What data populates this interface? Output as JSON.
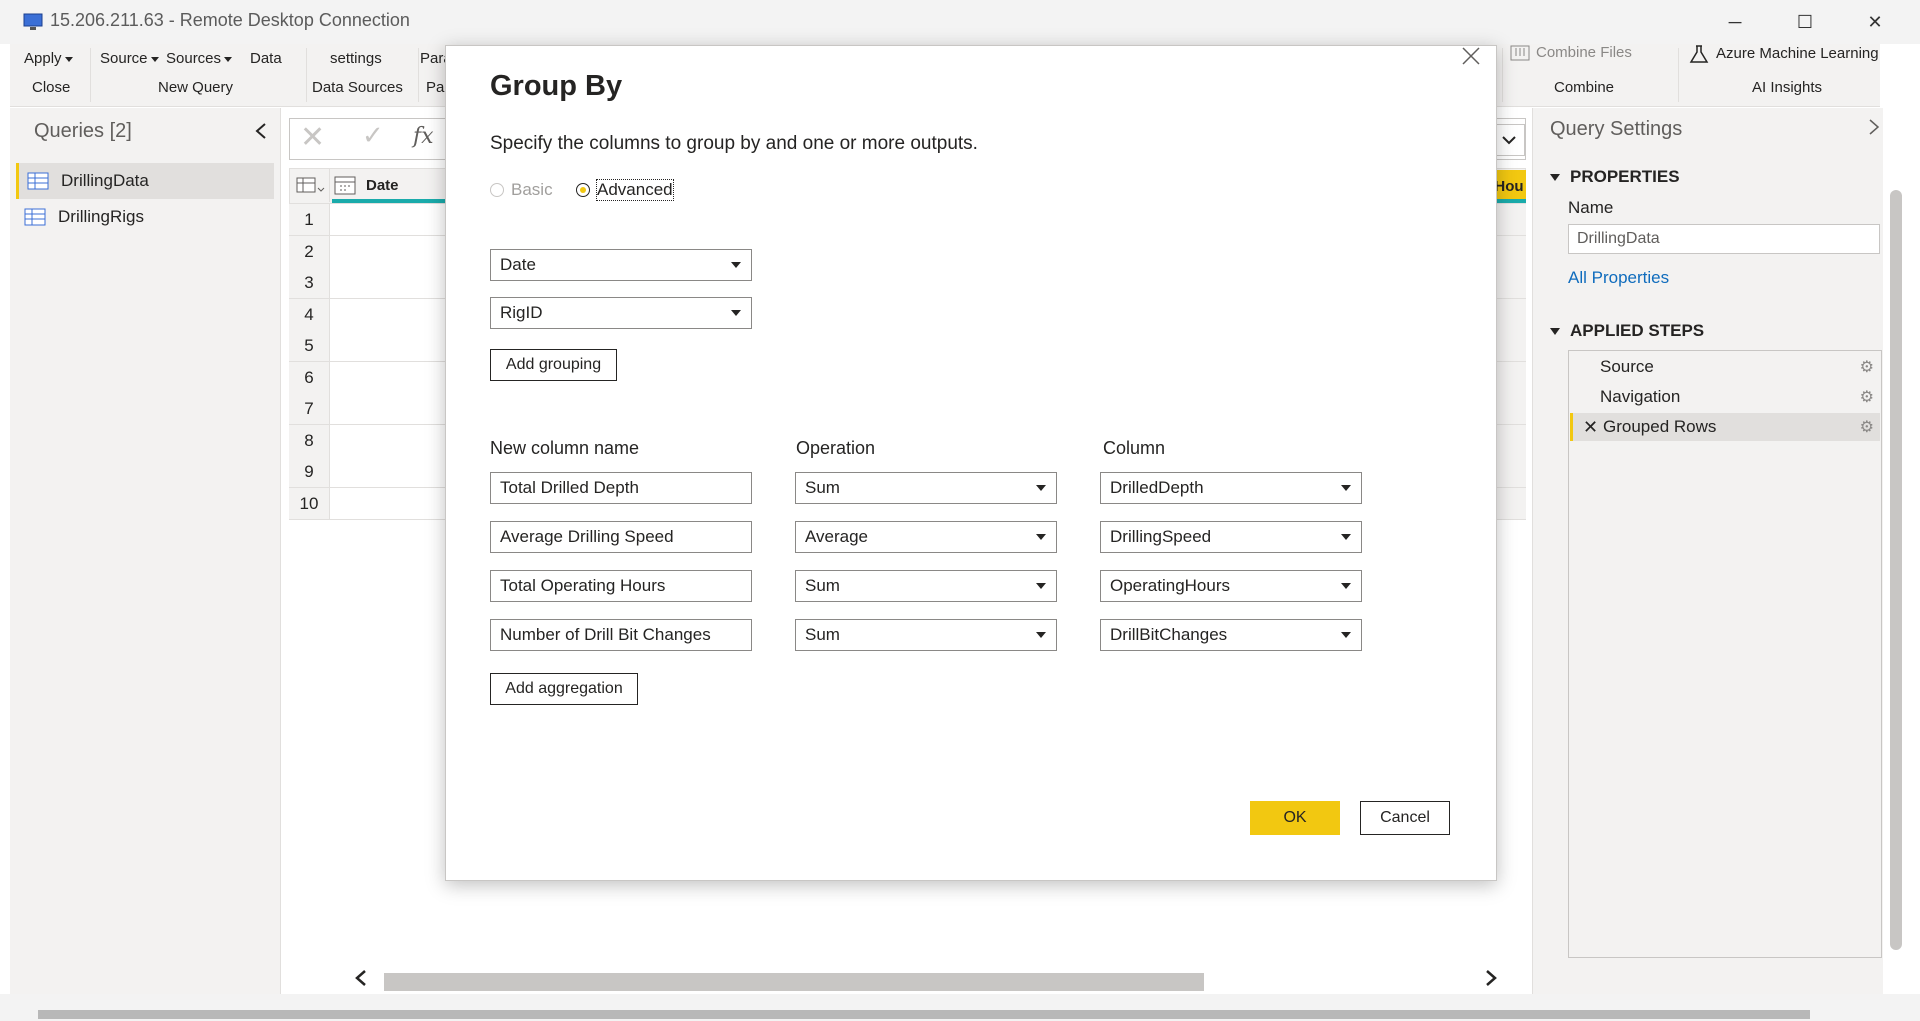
{
  "window": {
    "title": "15.206.211.63 - Remote Desktop Connection",
    "minimize_glyph": "─",
    "maximize_glyph": "☐",
    "close_glyph": "✕"
  },
  "ribbon": {
    "apply_label": "Apply",
    "close_group": "Close",
    "source_label": "Source",
    "sources_label": "Sources",
    "data_label": "Data",
    "new_query_group": "New Query",
    "settings_label": "settings",
    "data_sources_group": "Data Sources",
    "para_label": "Para",
    "par_group": "Par",
    "combine_files_label": "Combine Files",
    "combine_group": "Combine",
    "azure_ml_label": "Azure Machine Learning",
    "ai_insights_group": "AI Insights"
  },
  "queries": {
    "title": "Queries [2]",
    "items": [
      {
        "label": "DrillingData",
        "selected": true
      },
      {
        "label": "DrillingRigs",
        "selected": false
      }
    ]
  },
  "grid": {
    "fx_label": "fx",
    "date_header": "Date",
    "partial_header": "Hou",
    "row_numbers": [
      "1",
      "2",
      "3",
      "4",
      "5",
      "6",
      "7",
      "8",
      "9",
      "10"
    ]
  },
  "query_settings": {
    "title": "Query Settings",
    "properties_header": "PROPERTIES",
    "name_label": "Name",
    "name_value": "DrillingData",
    "all_properties_link": "All Properties",
    "applied_steps_header": "APPLIED STEPS",
    "steps": [
      {
        "label": "Source",
        "active": false
      },
      {
        "label": "Navigation",
        "active": false
      },
      {
        "label": "Grouped Rows",
        "active": true
      }
    ]
  },
  "dialog": {
    "title": "Group By",
    "description": "Specify the columns to group by and one or more outputs.",
    "mode_basic": "Basic",
    "mode_advanced": "Advanced",
    "selected_mode": "Advanced",
    "groupings": [
      "Date",
      "RigID"
    ],
    "add_grouping_label": "Add grouping",
    "headers": {
      "new_column_name": "New column name",
      "operation": "Operation",
      "column": "Column"
    },
    "aggregations": [
      {
        "name": "Total Drilled Depth",
        "operation": "Sum",
        "column": "DrilledDepth"
      },
      {
        "name": "Average Drilling Speed",
        "operation": "Average",
        "column": "DrillingSpeed"
      },
      {
        "name": "Total Operating Hours",
        "operation": "Sum",
        "column": "OperatingHours"
      },
      {
        "name": "Number of Drill Bit Changes",
        "operation": "Sum",
        "column": "DrillBitChanges"
      }
    ],
    "add_aggregation_label": "Add aggregation",
    "ok_label": "OK",
    "cancel_label": "Cancel"
  },
  "colors": {
    "accent_yellow": "#f2c811",
    "teal": "#1aabab",
    "link_blue": "#0f6cbd"
  }
}
